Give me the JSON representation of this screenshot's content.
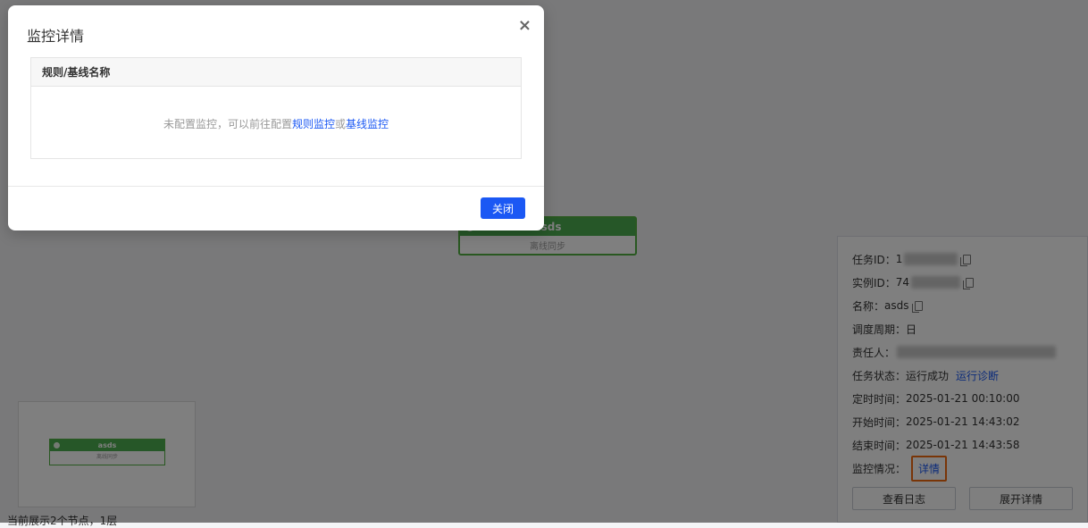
{
  "modal": {
    "title": "监控详情",
    "close_icon": "×",
    "table_header": "规则/基线名称",
    "empty_prefix": "未配置监控，可以前往配置",
    "link_rule": "规则监控",
    "empty_or": "或",
    "link_baseline": "基线监控",
    "primary_button": "关闭"
  },
  "node": {
    "name": "asds",
    "type": "离线同步"
  },
  "minimap": {
    "name": "asds",
    "type": "离线同步"
  },
  "stats": "当前展示2个节点，1层",
  "panel": {
    "task_id_label": "任务ID：",
    "task_id_value": "1",
    "instance_id_label": "实例ID：",
    "instance_id_value": "74",
    "name_label": "名称：",
    "name_value": "asds",
    "cycle_label": "调度周期：",
    "cycle_value": "日",
    "owner_label": "责任人：",
    "status_label": "任务状态：",
    "status_value": "运行成功",
    "diagnose_link": "运行诊断",
    "scheduled_label": "定时时间：",
    "scheduled_value": "2025-01-21 00:10:00",
    "start_label": "开始时间：",
    "start_value": "2025-01-21 14:43:02",
    "end_label": "结束时间：",
    "end_value": "2025-01-21 14:43:58",
    "monitor_label": "监控情况：",
    "monitor_link": "详情",
    "log_button": "查看日志",
    "expand_button": "展开详情"
  },
  "colors": {
    "primary": "#1b58f4",
    "node_green": "#4caf50",
    "highlight": "#f36b0e"
  }
}
